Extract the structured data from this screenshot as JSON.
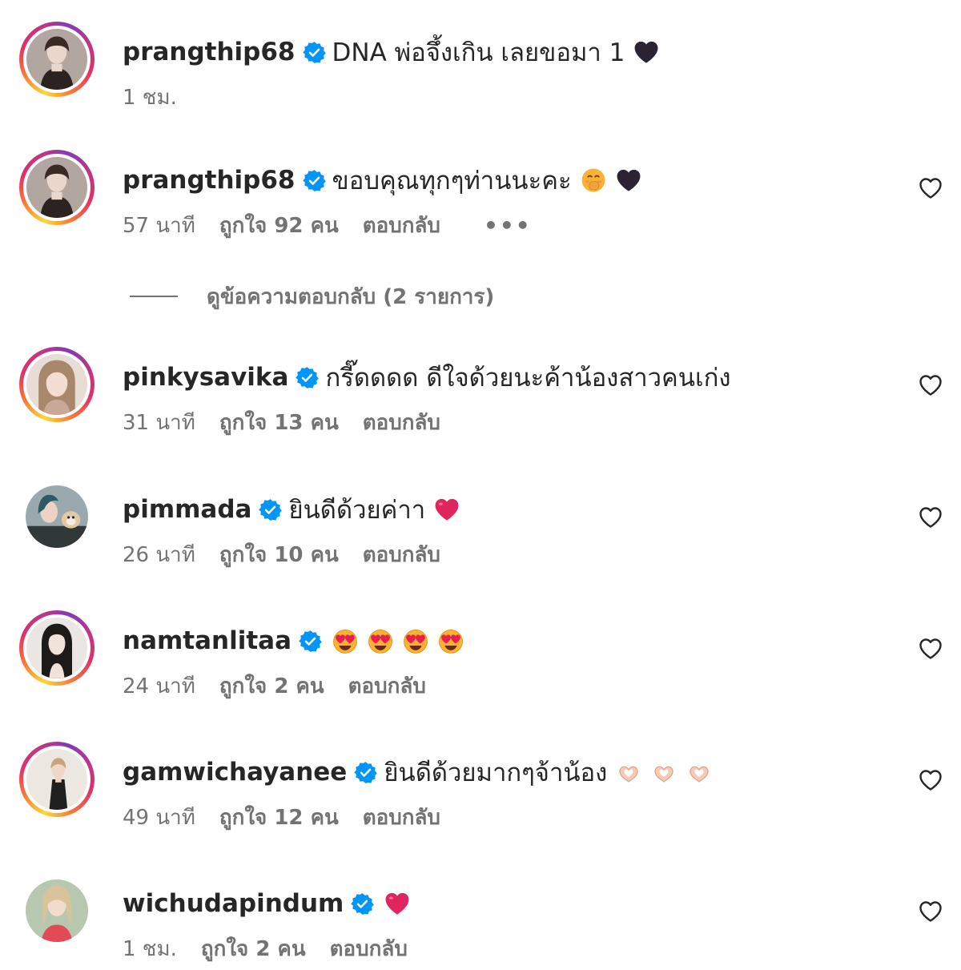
{
  "comments": [
    {
      "username": "prangthip68",
      "text": "DNA พ่อจึ้งเกิน เลยขอมา 1",
      "emojis": [
        "black-heart"
      ],
      "time": "1 ชม.",
      "likes": "",
      "reply": "",
      "more": "",
      "has_like_button": false,
      "avatar_ring": true
    },
    {
      "username": "prangthip68",
      "text": "ขอบคุณทุกๆท่านนะคะ",
      "emojis": [
        "smiling-face-hand-over-mouth",
        "black-heart"
      ],
      "time": "57 นาที",
      "likes": "ถูกใจ 92 คน",
      "reply": "ตอบกลับ",
      "more": "•••",
      "has_like_button": true,
      "avatar_ring": true
    },
    {
      "username": "pinkysavika",
      "text": "กรี๊ดดดด ดีใจด้วยนะค้าน้องสาวคนเก่ง",
      "emojis": [],
      "time": "31 นาที",
      "likes": "ถูกใจ 13 คน",
      "reply": "ตอบกลับ",
      "more": "",
      "has_like_button": true,
      "avatar_ring": true
    },
    {
      "username": "pimmada",
      "text": "ยินดีด้วยค่าา",
      "emojis": [
        "red-heart"
      ],
      "time": "26 นาที",
      "likes": "ถูกใจ 10 คน",
      "reply": "ตอบกลับ",
      "more": "",
      "has_like_button": true,
      "avatar_ring": false
    },
    {
      "username": "namtanlitaa",
      "text": "",
      "emojis": [
        "heart-eyes",
        "heart-eyes",
        "heart-eyes",
        "heart-eyes"
      ],
      "time": "24 นาที",
      "likes": "ถูกใจ 2 คน",
      "reply": "ตอบกลับ",
      "more": "",
      "has_like_button": true,
      "avatar_ring": true
    },
    {
      "username": "gamwichayanee",
      "text": "ยินดีด้วยมากๆจ้าน้อง",
      "emojis": [
        "heart-hands",
        "heart-hands",
        "heart-hands"
      ],
      "time": "49 นาที",
      "likes": "ถูกใจ 12 คน",
      "reply": "ตอบกลับ",
      "more": "",
      "has_like_button": true,
      "avatar_ring": true
    },
    {
      "username": "wichudapindum",
      "text": "",
      "emojis": [
        "red-heart"
      ],
      "time": "1 ชม.",
      "likes": "ถูกใจ 2 คน",
      "reply": "ตอบกลับ",
      "more": "",
      "has_like_button": true,
      "avatar_ring": false
    }
  ],
  "view_replies": "ดูข้อความตอบกลับ (2 รายการ)",
  "colors": {
    "text": "#262626",
    "secondary": "#737373",
    "verified": "#0095f6"
  }
}
